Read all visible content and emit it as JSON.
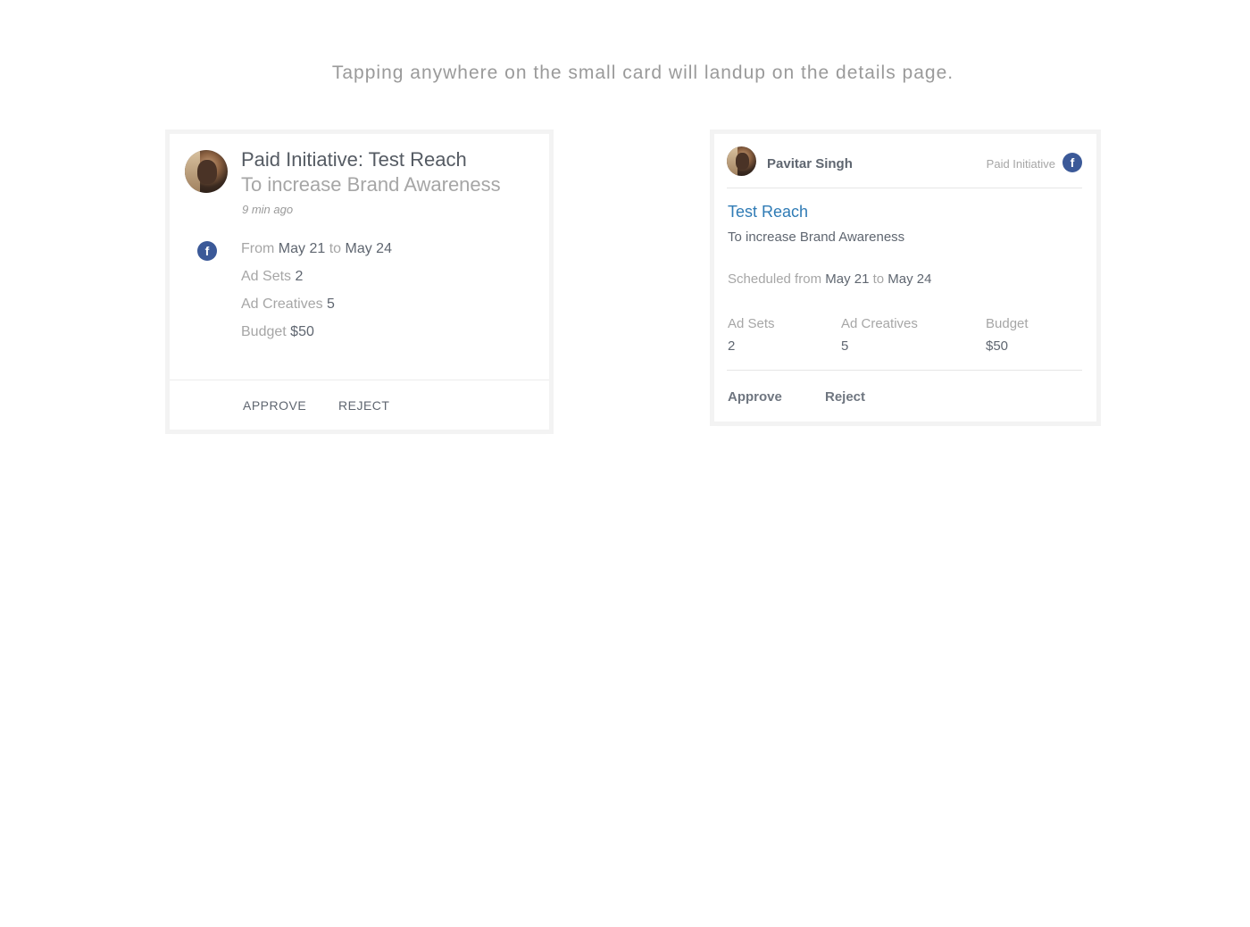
{
  "caption": "Tapping anywhere on the small card will landup on the details page.",
  "colors": {
    "facebook": "#3b5998",
    "link": "#2f7bb5",
    "muted": "#a6a6a6",
    "text": "#5f6670"
  },
  "card_small": {
    "avatar_icon": "user-avatar",
    "title": "Paid Initiative: Test Reach",
    "subtitle": "To increase Brand Awareness",
    "time": "9 min ago",
    "network_icon": "facebook-icon",
    "network_glyph": "f",
    "from_label": "From",
    "from_date": "May 21",
    "to_label": "to",
    "to_date": "May 24",
    "ad_sets_label": "Ad Sets",
    "ad_sets_value": "2",
    "ad_creatives_label": "Ad Creatives",
    "ad_creatives_value": "5",
    "budget_label": "Budget",
    "budget_value": "$50",
    "approve_label": "APPROVE",
    "reject_label": "REJECT"
  },
  "card_details": {
    "avatar_icon": "user-avatar",
    "user_name": "Pavitar Singh",
    "type_label": "Paid Initiative",
    "network_icon": "facebook-icon",
    "network_glyph": "f",
    "title": "Test Reach",
    "subtitle": "To increase Brand Awareness",
    "scheduled_label": "Scheduled from",
    "from_date": "May 21",
    "to_label": "to",
    "to_date": "May 24",
    "stats": [
      {
        "label": "Ad Sets",
        "value": "2"
      },
      {
        "label": "Ad Creatives",
        "value": "5"
      },
      {
        "label": "Budget",
        "value": "$50"
      }
    ],
    "approve_label": "Approve",
    "reject_label": "Reject"
  }
}
